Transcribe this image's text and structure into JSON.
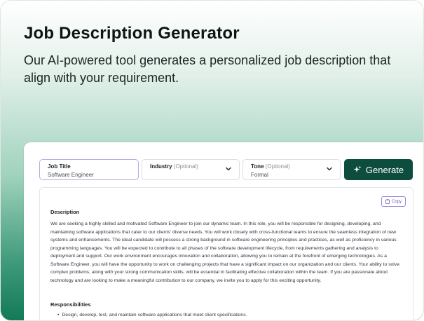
{
  "hero": {
    "title": "Job Description Generator",
    "subtitle": "Our AI-powered tool generates a personalized job description that align with your requirement."
  },
  "form": {
    "job_title": {
      "label": "Job Title",
      "value": "Software Engineer"
    },
    "industry": {
      "label": "Industry",
      "optional": "(Optional)",
      "value": ""
    },
    "tone": {
      "label": "Tone",
      "optional": "(Optional)",
      "value": "Formal"
    },
    "generate_label": "Generate"
  },
  "output": {
    "copy_label": "Copy",
    "description_heading": "Description",
    "description_text": "We are seeking a highly skilled and motivated Software Engineer to join our dynamic team. In this role, you will be responsible for designing, developing, and maintaining software applications that cater to our clients' diverse needs. You will work closely with cross-functional teams to ensure the seamless integration of new systems and enhancements. The ideal candidate will possess a strong background in software engineering principles and practices, as well as proficiency in various programming languages. You will be expected to contribute to all phases of the software development lifecycle, from requirements gathering and analysis to deployment and support. Our work environment encourages innovation and collaboration, allowing you to remain at the forefront of emerging technologies. As a Software Engineer, you will have the opportunity to work on challenging projects that have a significant impact on our organization and our clients. Your ability to solve complex problems, along with your strong communication skills, will be essential in facilitating effective collaboration within the team. If you are passionate about technology and are looking to make a meaningful contribution to our company, we invite you to apply for this exciting opportunity.",
    "responsibilities_heading": "Responsibilities",
    "responsibilities": [
      "Design, develop, test, and maintain software applications that meet client specifications."
    ]
  },
  "colors": {
    "brand_dark": "#0d4d3d",
    "accent_purple": "#6d55c4"
  },
  "icons": {
    "generate": "sparkle-icon",
    "copy": "clipboard-icon",
    "dropdown": "chevron-down-icon"
  }
}
